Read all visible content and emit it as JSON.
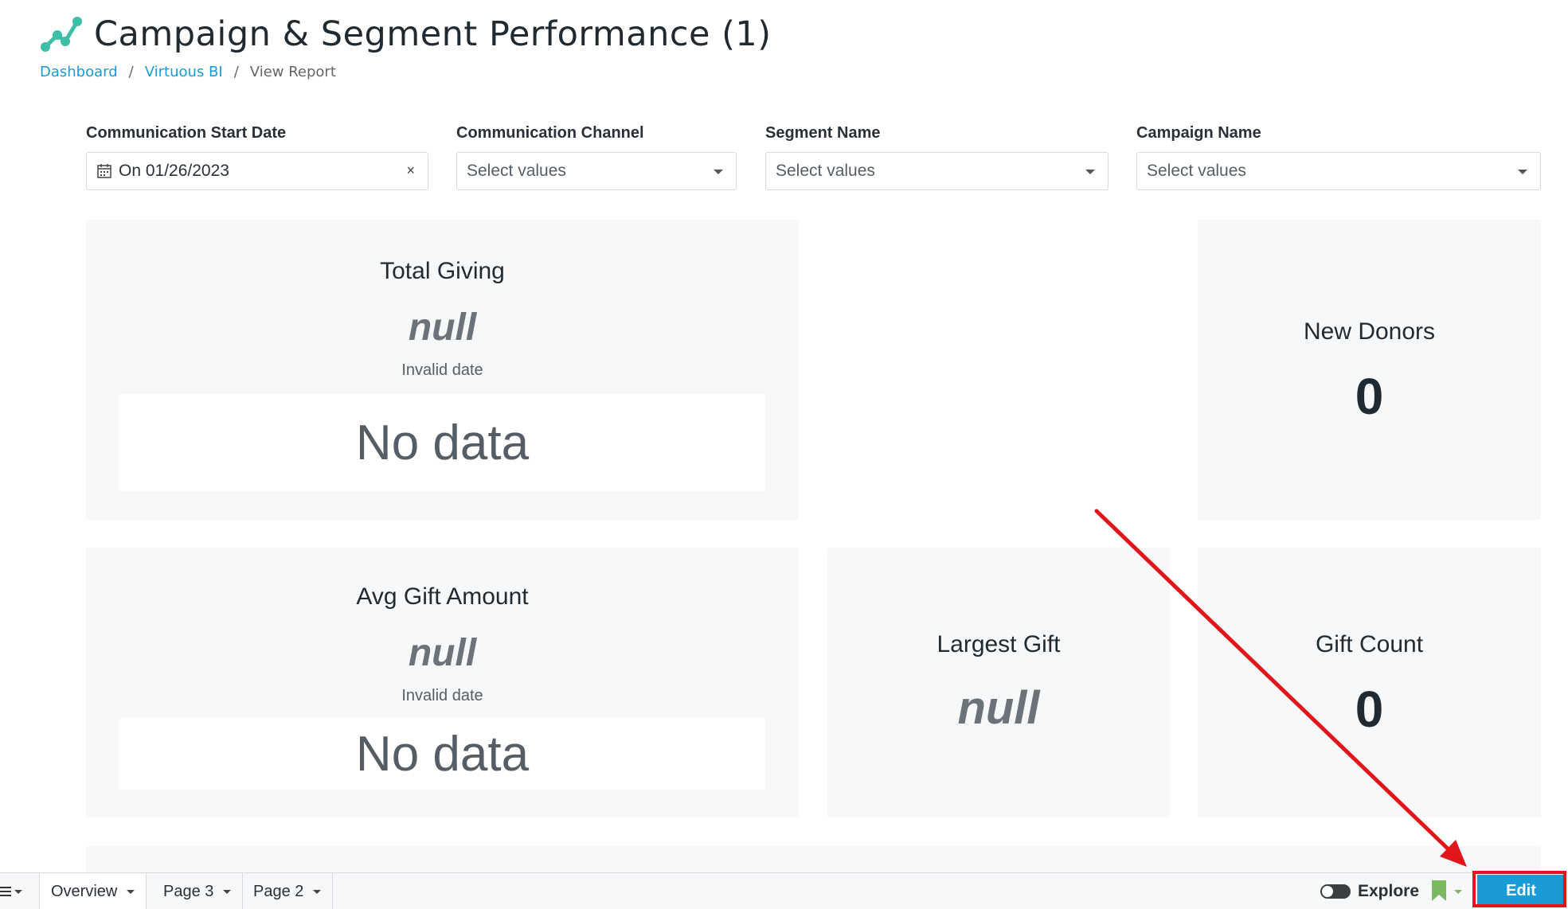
{
  "header": {
    "title": "Campaign & Segment Performance (1)",
    "logo_icon": "line-chart-logo-icon"
  },
  "breadcrumb": {
    "items": [
      "Dashboard",
      "Virtuous BI"
    ],
    "current": "View Report",
    "separator": "/"
  },
  "filters": [
    {
      "label": "Communication Start Date",
      "value": "On 01/26/2023",
      "icon": "calendar-icon"
    },
    {
      "label": "Communication Channel",
      "placeholder": "Select values"
    },
    {
      "label": "Segment Name",
      "placeholder": "Select values"
    },
    {
      "label": "Campaign Name",
      "placeholder": "Select values"
    }
  ],
  "cards": {
    "total_giving": {
      "title": "Total Giving",
      "value": "null",
      "subtitle": "Invalid date",
      "nodata": "No data"
    },
    "new_donors": {
      "title": "New Donors",
      "value": "0"
    },
    "avg_gift": {
      "title": "Avg Gift Amount",
      "value": "null",
      "subtitle": "Invalid date",
      "nodata": "No data"
    },
    "largest_gift": {
      "title": "Largest Gift",
      "value": "null"
    },
    "gift_count": {
      "title": "Gift Count",
      "value": "0"
    }
  },
  "bottom_bar": {
    "tabs": [
      {
        "label": "Overview",
        "active": true
      },
      {
        "label": "Page 3",
        "active": false
      },
      {
        "label": "Page 2",
        "active": false
      }
    ],
    "explore_label": "Explore",
    "edit_label": "Edit"
  },
  "colors": {
    "accent": "#1a9bd7",
    "logo": "#3cbfa6",
    "bookmark": "#7ab861",
    "annotation": "#e0161b"
  }
}
